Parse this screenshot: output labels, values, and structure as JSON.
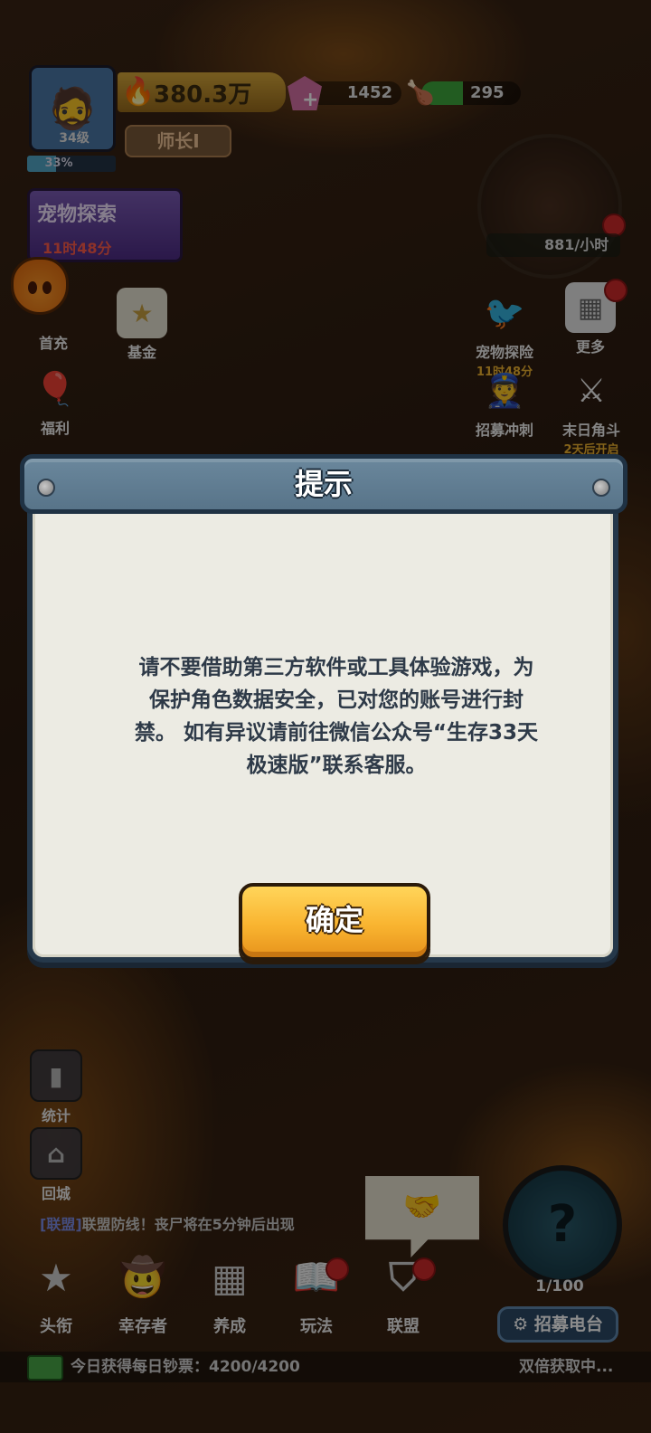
{
  "hud": {
    "level": "34级",
    "exp_percent": "33%",
    "exp_fraction": 0.33,
    "power": "380.3万",
    "rank": "师长Ⅰ",
    "gems": "1452",
    "meat": "295",
    "meat_fraction": 0.42,
    "production_rate": "881/小时"
  },
  "pet_explore": {
    "title": "宠物探索",
    "timer": "11时48分"
  },
  "left_icons": [
    {
      "label": "首充",
      "icon": "gift-icon"
    },
    {
      "label": "基金",
      "icon": "book-icon"
    },
    {
      "label": "福利",
      "icon": "balloon-icon"
    }
  ],
  "right_icons": [
    {
      "label": "宠物探险",
      "sub": "11时48分",
      "icon": "bird-icon"
    },
    {
      "label": "更多",
      "icon": "grid-icon"
    },
    {
      "label": "招募冲刺",
      "icon": "soldiers-icon"
    },
    {
      "label": "末日角斗",
      "sub": "2天后开启",
      "icon": "swords-icon"
    }
  ],
  "dialog": {
    "title": "提示",
    "message": "请不要借助第三方软件或工具体验游戏，为\n保护角色数据安全，已对您的账号进行封\n禁。 如有异议请前往微信公众号“生存33天\n极速版”联系客服。",
    "confirm_label": "确定"
  },
  "controls": [
    {
      "label": "统计",
      "icon": "bar-chart-icon"
    },
    {
      "label": "回城",
      "icon": "house-icon"
    }
  ],
  "ticker": {
    "tag": "[联盟]",
    "text": "联盟防线！丧尸将在5分钟后出现"
  },
  "radar": {
    "count": "1/100",
    "recruit_label": "招募电台"
  },
  "bottom_nav": [
    {
      "label": "头衔",
      "icon": "star-badge-icon"
    },
    {
      "label": "幸存者",
      "icon": "cowboy-hat-icon"
    },
    {
      "label": "养成",
      "icon": "grid-icon"
    },
    {
      "label": "玩法",
      "icon": "open-book-icon"
    },
    {
      "label": "联盟",
      "icon": "shield-icon"
    }
  ],
  "daily": {
    "text": "今日获得每日钞票：4200/4200",
    "double": "双倍获取中..."
  },
  "colors": {
    "dialog_bg": "#ecebe3",
    "dialog_header": "#587489",
    "confirm_button": "#f9b430",
    "message_text": "#2e3a48"
  }
}
